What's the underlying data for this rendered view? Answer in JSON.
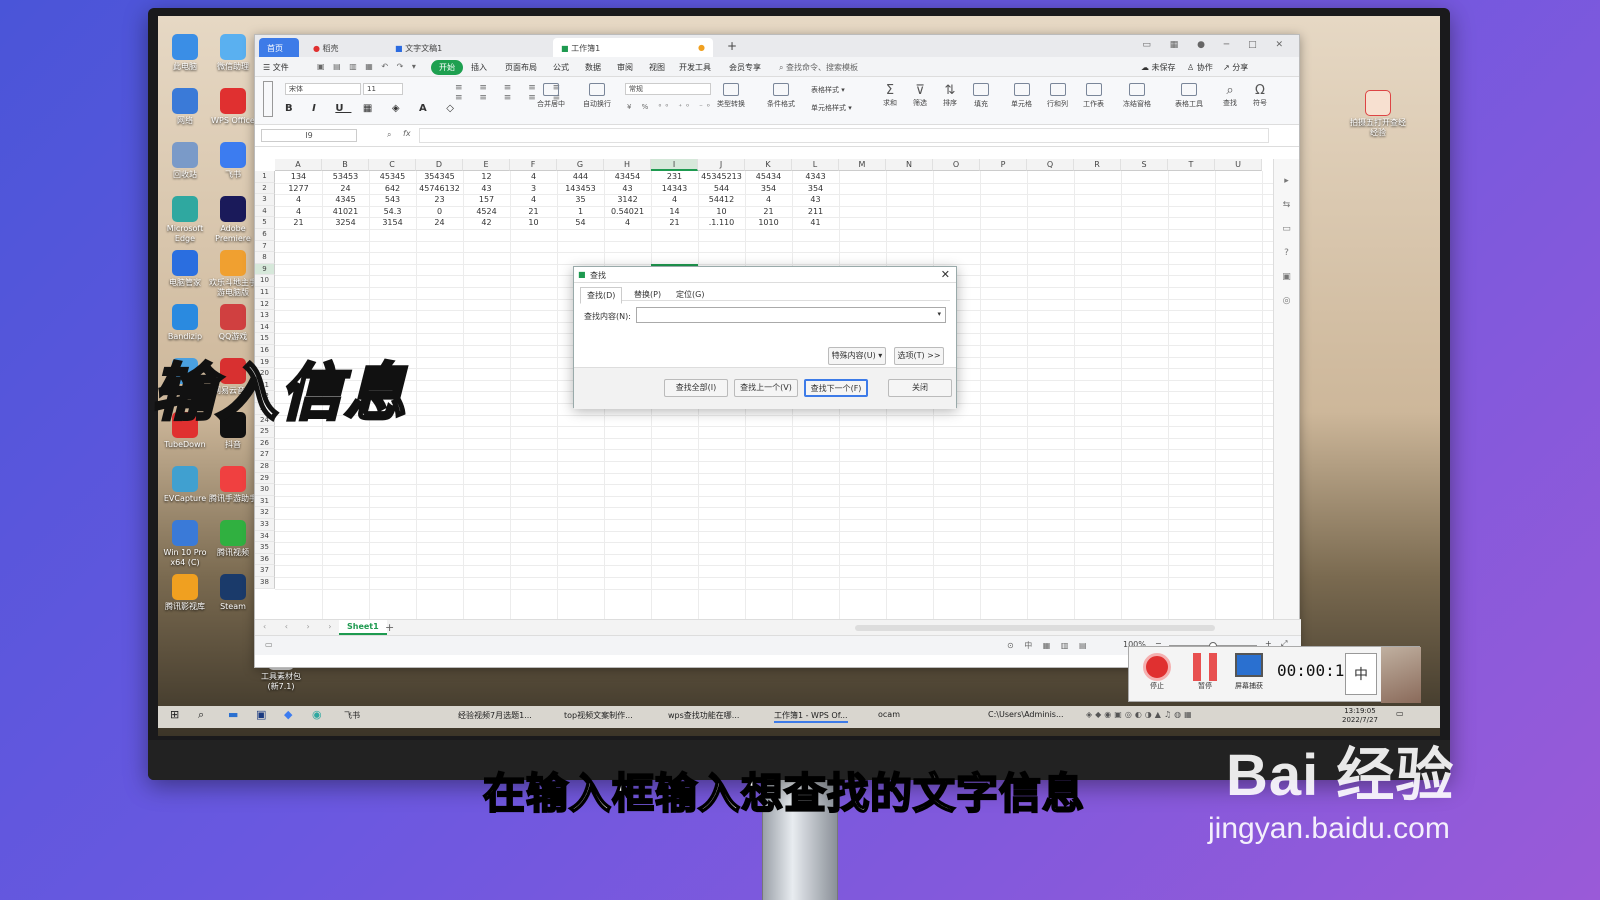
{
  "desktop_icons": [
    {
      "label": "此电脑",
      "color": "#3a8ee6"
    },
    {
      "label": "微信助理",
      "color": "#5ab0f0"
    },
    {
      "label": "网络",
      "color": "#3a7ad8"
    },
    {
      "label": "WPS Office",
      "color": "#e03030"
    },
    {
      "label": "回收站",
      "color": "#7a9ac8"
    },
    {
      "label": "飞书",
      "color": "#3c7cf0"
    },
    {
      "label": "Microsoft Edge",
      "color": "#2fa8a0"
    },
    {
      "label": "Adobe Premiere",
      "color": "#1a1a5a"
    },
    {
      "label": "电脑管家",
      "color": "#2a6ee0"
    },
    {
      "label": "欢乐斗地主手游电脑版",
      "color": "#f0a030"
    },
    {
      "label": "Bandizip",
      "color": "#2a8ae0"
    },
    {
      "label": "QQ游戏",
      "color": "#d04040"
    },
    {
      "label": "格式工厂",
      "color": "#4aa0e0"
    },
    {
      "label": "网易云音乐",
      "color": "#d83030"
    },
    {
      "label": "TubeDown",
      "color": "#e03030"
    },
    {
      "label": "抖音",
      "color": "#111111"
    },
    {
      "label": "EVCapture",
      "color": "#40a0d0"
    },
    {
      "label": "腾讯手游助手",
      "color": "#f04040"
    },
    {
      "label": "Win 10 Pro x64 (C)",
      "color": "#3a7ad8"
    },
    {
      "label": "腾讯视频",
      "color": "#30b040"
    },
    {
      "label": "腾讯影视库",
      "color": "#f0a020"
    },
    {
      "label": "Steam",
      "color": "#1a3a6a"
    },
    {
      "label": "工具素材包(新7.1)",
      "color": "#dddddd"
    }
  ],
  "tabs": {
    "home": "首页",
    "daoke": "稻壳",
    "doc": "文字文稿1",
    "book": "工作簿1",
    "new": "+"
  },
  "menu": {
    "file": "文件",
    "start": "开始",
    "insert": "插入",
    "layout": "页面布局",
    "formula": "公式",
    "data": "数据",
    "review": "审阅",
    "view": "视图",
    "dev": "开发工具",
    "member": "会员专享",
    "search": "查找命令、搜索模板",
    "unsaved": "未保存",
    "collab": "协作",
    "share": "分享"
  },
  "toolbar": {
    "font": "宋体",
    "size": "11",
    "number_format": "常规",
    "merge": "合并居中",
    "wrap": "自动换行",
    "convert": "类型转换",
    "cond_format": "条件格式",
    "table_style": "表格样式",
    "cell_style": "单元格样式",
    "sum": "求和",
    "filter": "筛选",
    "sort": "排序",
    "fill": "填充",
    "cell": "单元格",
    "rowcol": "行和列",
    "sheet": "工作表",
    "freeze": "冻结窗格",
    "tools": "表格工具",
    "find": "查找",
    "symbol": "符号"
  },
  "formula_bar": {
    "name_box": "I9",
    "fx": "fx"
  },
  "grid": {
    "columns": [
      "A",
      "B",
      "C",
      "D",
      "E",
      "F",
      "G",
      "H",
      "I",
      "J",
      "K",
      "L",
      "M",
      "N",
      "O",
      "P",
      "Q",
      "R",
      "S",
      "T",
      "U"
    ],
    "rows": [
      "1",
      "2",
      "3",
      "4",
      "5",
      "6",
      "7",
      "8",
      "9",
      "10",
      "11",
      "12",
      "13",
      "14",
      "15",
      "16",
      "19",
      "20",
      "21",
      "22",
      "23",
      "24",
      "25",
      "26",
      "27",
      "28",
      "29",
      "30",
      "31",
      "32",
      "33",
      "34",
      "35",
      "36",
      "37",
      "38"
    ],
    "data": [
      [
        "134",
        "53453",
        "45345",
        "354345",
        "12",
        "4",
        "444",
        "43454",
        "231",
        "45345213",
        "45434",
        "4343"
      ],
      [
        "1277",
        "24",
        "642",
        "45746132",
        "43",
        "3",
        "143453",
        "43",
        "14343",
        "544",
        "354",
        "354"
      ],
      [
        "4",
        "4345",
        "543",
        "23",
        "157",
        "4",
        "35",
        "3142",
        "4",
        "54412",
        "4",
        "43"
      ],
      [
        "4",
        "41021",
        "54.3",
        "0",
        "4524",
        "21",
        "1",
        "0.54021",
        "14",
        "10",
        "21",
        "211"
      ],
      [
        "21",
        "3254",
        "3154",
        "24",
        "42",
        "10",
        "54",
        "4",
        "21",
        ".1.110",
        "1010",
        "41"
      ]
    ]
  },
  "sheet": {
    "name": "Sheet1",
    "add": "+"
  },
  "status": {
    "zoom": "100%"
  },
  "dialog": {
    "title": "查找",
    "tabs": [
      "查找(D)",
      "替换(P)",
      "定位(G)"
    ],
    "label": "查找内容(N):",
    "input_value": "",
    "special": "特殊内容(U) ▾",
    "options": "选项(T) >>",
    "buttons": [
      "查找全部(I)",
      "查找上一个(V)",
      "查找下一个(F)",
      "关闭"
    ]
  },
  "taskbar": {
    "items": [
      "飞书",
      "经验视频7月选题1...",
      "top视频文案制作...",
      "wps查找功能在哪...",
      "工作簿1 - WPS Of...",
      "ocam",
      "C:\\Users\\Adminis..."
    ],
    "time": "13:19:05",
    "date": "2022/7/27"
  },
  "recorder": {
    "stop": "停止",
    "pause": "暂停",
    "screen": "屏幕捕获",
    "timer": "00:00:1",
    "ime": "中"
  },
  "right_desktop_icon": "拍摄五打开查经经验",
  "overlay_title": "输入信息",
  "subtitle": "在输入框输入想查找的文字信息",
  "watermark": {
    "brand": "Bai  经验",
    "url": "jingyan.baidu.com"
  }
}
